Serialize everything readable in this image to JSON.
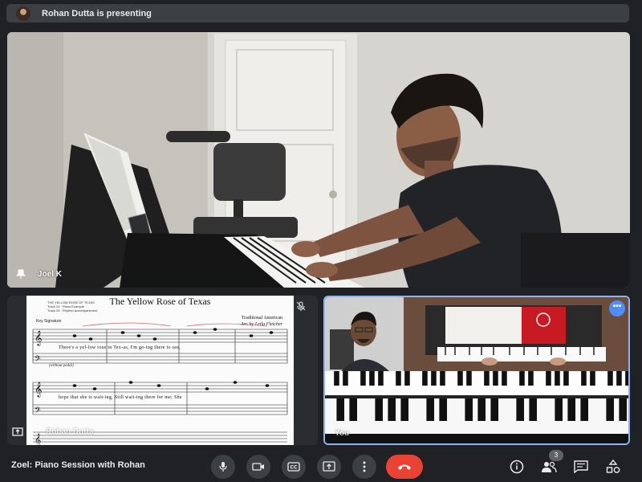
{
  "presenting": {
    "text": "Rohan Dutta is presenting"
  },
  "tiles": {
    "main": {
      "name": "Joel K"
    },
    "self": {
      "name": "You"
    },
    "sheet": {
      "name": "Rohan Dutta"
    }
  },
  "sheet_music": {
    "title": "The Yellow Rose of Texas",
    "header_lines": [
      "THE YELLOW ROSE OF TEXAS",
      "Track 24 · Piano Example",
      "Track 25 · Rhythm Accompaniment"
    ],
    "key_signature": "Key Signature",
    "composer_line1": "Traditional American",
    "composer_line2": "Arr. by Leila Fletcher",
    "lyrics_line1": "There's a yel-low rose in Tex-as, I'm go-ing there to see,",
    "lyrics_line2": "hope that she is wait-ing, Still wait-ing there for me; She",
    "pedal_text": "(without pedal)"
  },
  "controls": {
    "meeting_title": "Zoel: Piano Session with Rohan",
    "participant_count": "3",
    "end_color": "#ea4335",
    "icons": [
      "mic-icon",
      "camera-icon",
      "captions-icon",
      "present-icon",
      "more-vert-icon",
      "end-call-icon",
      "info-icon",
      "people-icon",
      "chat-icon",
      "activities-icon"
    ]
  },
  "colors": {
    "background": "#202124",
    "bar": "#3c4043",
    "accent": "#8ab4f8"
  }
}
